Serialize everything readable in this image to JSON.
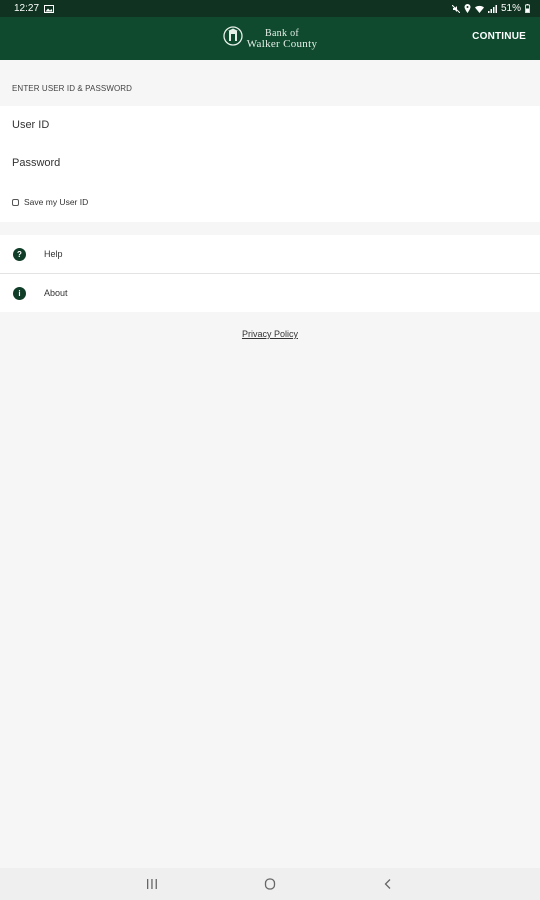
{
  "status_bar": {
    "time": "12:27",
    "battery": "51%",
    "icons": [
      "image-icon",
      "mute-icon",
      "location-icon",
      "wifi-icon",
      "signal-icon",
      "battery-icon"
    ]
  },
  "header": {
    "logo_line1": "Bank of",
    "logo_line2": "Walker County",
    "continue_label": "CONTINUE",
    "background_color": "#0f4a2e"
  },
  "login_form": {
    "section_label": "ENTER USER ID & PASSWORD",
    "user_id_placeholder": "User ID",
    "password_placeholder": "Password",
    "save_user_id_label": "Save my User ID",
    "save_user_id_checked": false
  },
  "menu": {
    "items": [
      {
        "label": "Help",
        "icon": "help-icon",
        "glyph": "?"
      },
      {
        "label": "About",
        "icon": "info-icon",
        "glyph": "i"
      }
    ]
  },
  "footer": {
    "privacy_label": "Privacy Policy"
  },
  "nav_bar": {
    "buttons": [
      "recents-button",
      "home-button",
      "back-button"
    ]
  }
}
